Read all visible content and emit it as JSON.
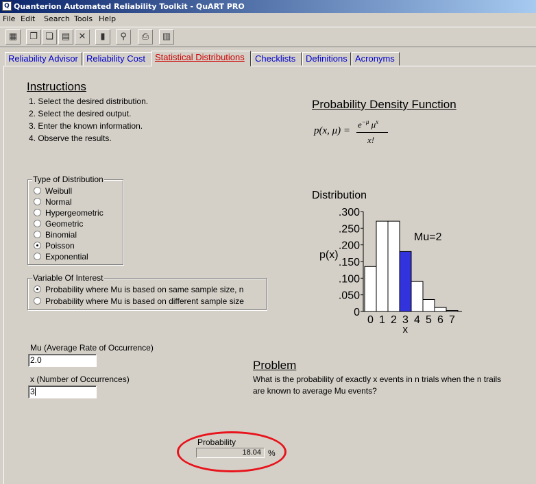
{
  "window": {
    "title": "Quanterion Automated Reliability Toolkit - QuART PRO"
  },
  "menu": [
    "File",
    "Edit",
    "Search",
    "Tools",
    "Help"
  ],
  "tabs": [
    "Reliability Advisor",
    "Reliability Cost",
    "Statistical Distributions",
    "Checklists",
    "Definitions",
    "Acronyms"
  ],
  "active_tab": "Statistical Distributions",
  "instructions": {
    "heading": "Instructions",
    "steps": [
      "1. Select the desired distribution.",
      "2. Select the desired output.",
      "3. Enter the known information.",
      "4. Observe the results."
    ]
  },
  "pdf": {
    "heading": "Probability Density Function",
    "formula_lhs": "p(x, μ) =",
    "formula_num_base": "e",
    "formula_num_exp": "−μ",
    "formula_num_mid": "μ",
    "formula_num_exp2": "x",
    "formula_den": "x!"
  },
  "distribution_type": {
    "legend": "Type of Distribution",
    "options": [
      "Weibull",
      "Normal",
      "Hypergeometric",
      "Geometric",
      "Binomial",
      "Poisson",
      "Exponential"
    ],
    "selected": "Poisson"
  },
  "variable_of_interest": {
    "legend": "Variable Of Interest",
    "options": [
      "Probability where Mu is based on same sample size, n",
      "Probability where Mu is based on different sample size"
    ],
    "selected": "Probability where Mu is based on same sample size, n"
  },
  "distribution_heading": "Distribution",
  "chart_data": {
    "type": "bar",
    "categories": [
      "0",
      "1",
      "2",
      "3",
      "4",
      "5",
      "6",
      "7"
    ],
    "values": [
      0.135,
      0.271,
      0.271,
      0.18,
      0.09,
      0.036,
      0.012,
      0.003
    ],
    "highlight_index": 3,
    "ylabel": "p(x)",
    "xlabel": "x",
    "yticks": [
      ".300",
      ".250",
      ".200",
      ".150",
      ".100",
      ".050",
      "0"
    ],
    "ylim": [
      0,
      0.3
    ],
    "annotation": "Mu=2",
    "colors": {
      "bar": "#ffffff",
      "highlight": "#3333dd",
      "outline": "#000000"
    }
  },
  "inputs": {
    "mu_label": "Mu (Average Rate of Occurrence)",
    "mu_value": "2.0",
    "x_label": "x (Number of Occurrences)",
    "x_value": "3"
  },
  "problem": {
    "heading": "Problem",
    "line1": "What is the probability of exactly x events in n trials when the n trails",
    "line2": "are known to average Mu events?"
  },
  "result": {
    "label": "Probability",
    "value": "18.04",
    "unit": "%"
  }
}
